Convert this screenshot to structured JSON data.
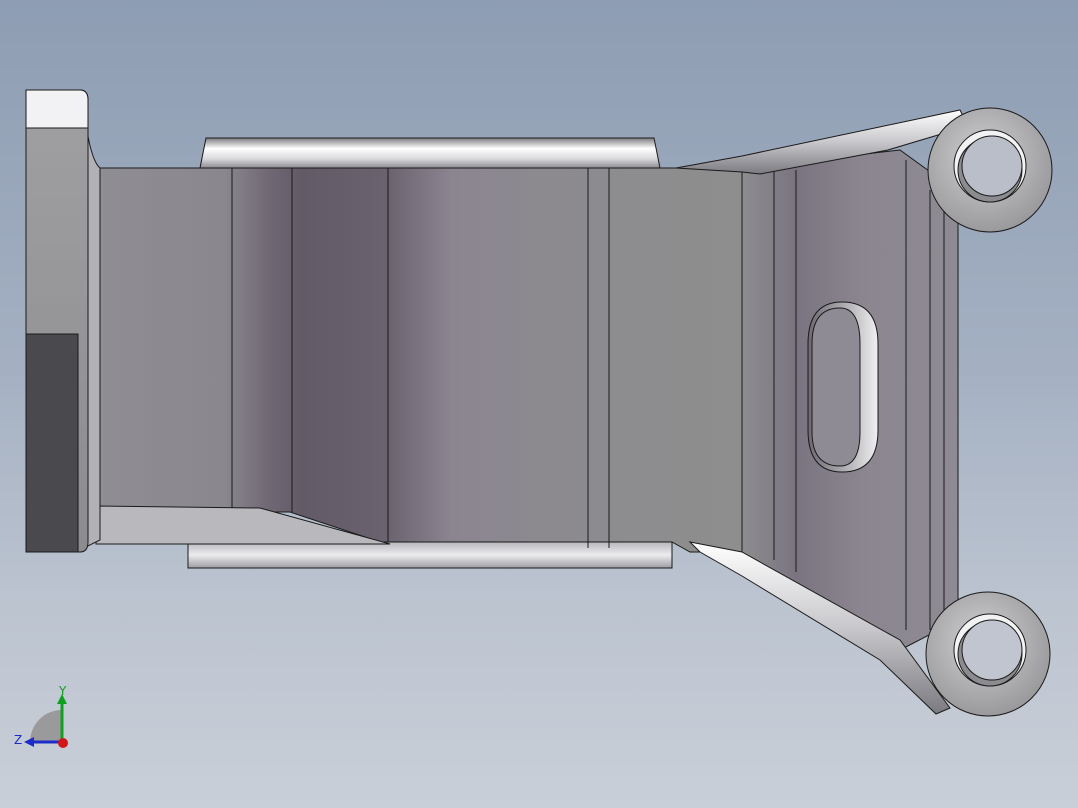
{
  "triad": {
    "y_label": "Y",
    "z_label": "Z",
    "x_color": "#d01818",
    "y_color": "#10a020",
    "z_color": "#1c2cc8"
  },
  "colors": {
    "background_top": "#8e9db3",
    "background_bottom": "#c9cfd8",
    "part_base": "#8d8b90",
    "part_shadow": "#4e4b52",
    "edge": "#1a1a1a"
  }
}
